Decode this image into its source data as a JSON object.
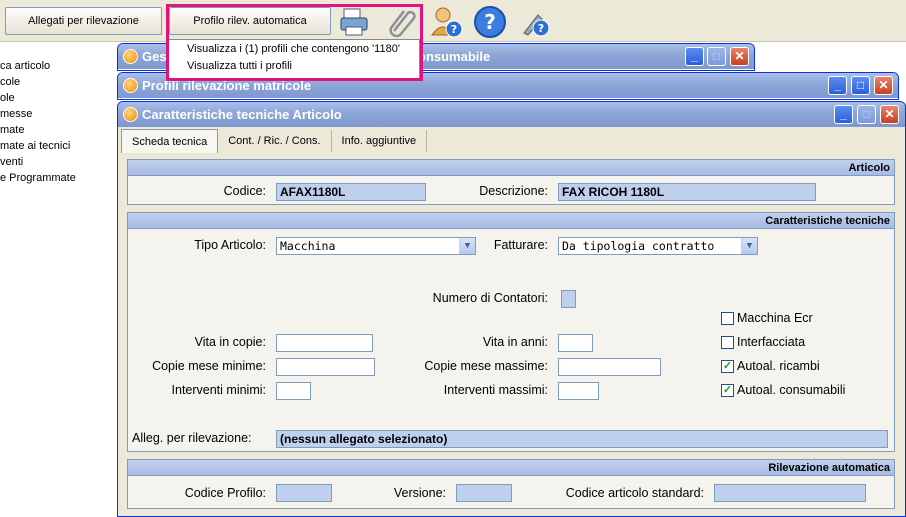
{
  "toolbar": {
    "btn_allegati": "Allegati per rilevazione",
    "btn_profilo": "Profilo rilev. automatica",
    "icons": [
      "printer-icon",
      "paperclip-icon",
      "user-help-icon",
      "help-icon",
      "tools-help-icon"
    ]
  },
  "popup": {
    "item1": "Visualizza i (1) profili che contengono '1180'",
    "item2": "Visualizza tutti i profili"
  },
  "sidebar": {
    "items": [
      "ca articolo",
      "cole",
      "ole",
      "messe",
      "mate",
      "mate ai tecnici",
      "venti",
      "e Programmate"
    ]
  },
  "windows": {
    "back1_title": "Gest",
    "back1_title_tail": "onsumabile",
    "back2_title": "Profili rilevazione matricole",
    "main_title": "Caratteristiche tecniche Articolo"
  },
  "tabs": [
    "Scheda tecnica",
    "Cont. / Ric. / Cons.",
    "Info. aggiuntive"
  ],
  "articolo": {
    "header": "Articolo",
    "codice_label": "Codice:",
    "codice_value": "AFAX1180L",
    "descrizione_label": "Descrizione:",
    "descrizione_value": "FAX RICOH 1180L"
  },
  "caratteristiche": {
    "header": "Caratteristiche tecniche",
    "tipo_label": "Tipo Articolo:",
    "tipo_value": "Macchina",
    "fatturare_label": "Fatturare:",
    "fatturare_value": "Da tipologia contratto",
    "contatori_label": "Numero di Contatori:",
    "vita_copie_label": "Vita in copie:",
    "vita_anni_label": "Vita in anni:",
    "copie_min_label": "Copie mese minime:",
    "copie_max_label": "Copie mese massime:",
    "interventi_min_label": "Interventi minimi:",
    "interventi_max_label": "Interventi massimi:",
    "checks": [
      {
        "label": "Macchina Ecr",
        "checked": false
      },
      {
        "label": "Interfacciata",
        "checked": false
      },
      {
        "label": "Autoal. ricambi",
        "checked": true
      },
      {
        "label": "Autoal. consumabili",
        "checked": true
      }
    ],
    "alleg_label": "Alleg. per rilevazione:",
    "alleg_value": "(nessun allegato selezionato)"
  },
  "rilevazione": {
    "header": "Rilevazione automatica",
    "codice_profilo_label": "Codice Profilo:",
    "versione_label": "Versione:",
    "codice_std_label": "Codice articolo standard:"
  }
}
